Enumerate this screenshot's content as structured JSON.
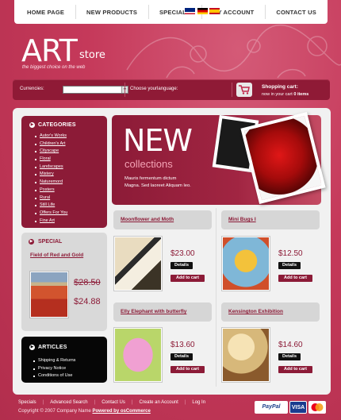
{
  "nav": {
    "items": [
      "HOME PAGE",
      "NEW PRODUCTS",
      "SPECIALS",
      "MY ACCOUNT",
      "CONTACT US"
    ]
  },
  "logo": {
    "art": "ART",
    "store": "store",
    "tagline": "the biggest choice on the web"
  },
  "toolbar": {
    "currencies_label": "Currencies:",
    "currency_value": "",
    "language_label": "Choose yourlanguage:",
    "cart_title": "Shopping cart:",
    "cart_prefix": "now in your cart",
    "cart_count": "0 items"
  },
  "categories": {
    "title": "CATEGORIES",
    "items": [
      "Autor's Works",
      "Children's Art",
      "Cityscape",
      "Floral",
      "Landscapes",
      "Mistery",
      "Naturemord",
      "Posters",
      "Rural",
      "Still Life",
      "Offers For You",
      "Fine Art"
    ]
  },
  "special": {
    "title": "SPECIAL",
    "name": "Field of Red and Gold",
    "old_price": "$28.50",
    "new_price": "$24.88"
  },
  "articles": {
    "title": "ARTICLES",
    "items": [
      "Shipping & Returns",
      "Privacy Notice",
      "Conditions of Use"
    ]
  },
  "banner": {
    "headline": "NEW",
    "subheadline": "collections",
    "line1": "Mauris fermentum dictum",
    "line2": "Magna. Sed laoreet Aliquam leo."
  },
  "products": [
    {
      "name": "Moonflower and Moth",
      "price": "$23.00"
    },
    {
      "name": "Mini Bugs I",
      "price": "$12.50"
    },
    {
      "name": "Elly Elephant with butterfly",
      "price": "$13.60"
    },
    {
      "name": "Kensington Exhibition",
      "price": "$14.60"
    }
  ],
  "buttons": {
    "details": "Details",
    "add_to_cart": "Add to cart"
  },
  "footer": {
    "links": [
      "Specials",
      "Advanced Search",
      "Contact Us",
      "Create an Account",
      "Log In"
    ],
    "copyright_prefix": "Copyright © 2007 Company Name",
    "powered": "Powered by osCommerce",
    "paypal": "PayPal",
    "visa": "VISA"
  },
  "colors": {
    "brand": "#8c1b37",
    "background": "#c83f5e",
    "accent_pink": "#f4a3b5"
  }
}
